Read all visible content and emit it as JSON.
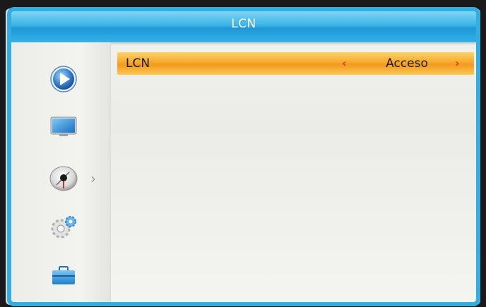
{
  "header": {
    "title": "LCN"
  },
  "sidebar": {
    "items": [
      {
        "icon": "play-icon",
        "color": "#2f7fc8"
      },
      {
        "icon": "monitor-icon",
        "color": "#2a8fd6"
      },
      {
        "icon": "satellite-dish-icon",
        "color": "#555555",
        "selected": true
      },
      {
        "icon": "gears-icon",
        "color": "#8a8a8a"
      },
      {
        "icon": "toolbox-icon",
        "color": "#2d97d8"
      }
    ],
    "selected_arrow": "›"
  },
  "settings": {
    "rows": [
      {
        "label": "LCN",
        "value": "Acceso",
        "arrow_left": "‹",
        "arrow_right": "›"
      }
    ]
  },
  "colors": {
    "accent": "#33aee0",
    "highlight": "#f7a82a",
    "arrow": "#e23a1e"
  }
}
